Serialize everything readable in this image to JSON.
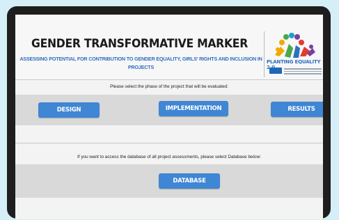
{
  "header": {
    "title": "GENDER TRANSFORMATIVE MARKER",
    "subtitle": "ASSESSING POTENTIAL FOR CONTRIBUTION TO GENDER EQUALITY, GIRLS' RIGHTS AND INCLUSION IN PROJECTS"
  },
  "logo": {
    "name": "PLANTING EQUALITY 2.0",
    "colors": [
      "#e03c31",
      "#f2a900",
      "#2f6fbf",
      "#4aa84a",
      "#7b3fa0",
      "#19a3c9"
    ]
  },
  "phase_section": {
    "prompt": "Please select the phase of the project that will be evaluated:",
    "buttons": {
      "design": "DESIGN",
      "implementation": "IMPLEMENTATION",
      "results": "RESULTS"
    }
  },
  "database_section": {
    "prompt": "If you want to access the database of all project assessments, please select Database below:",
    "button": "DATABASE"
  },
  "colors": {
    "button": "#3f86d4",
    "subtitle": "#2f6fbf",
    "band": "#d9d9d9",
    "frame": "#1e1e1e",
    "backdrop": "#d6eef7"
  }
}
